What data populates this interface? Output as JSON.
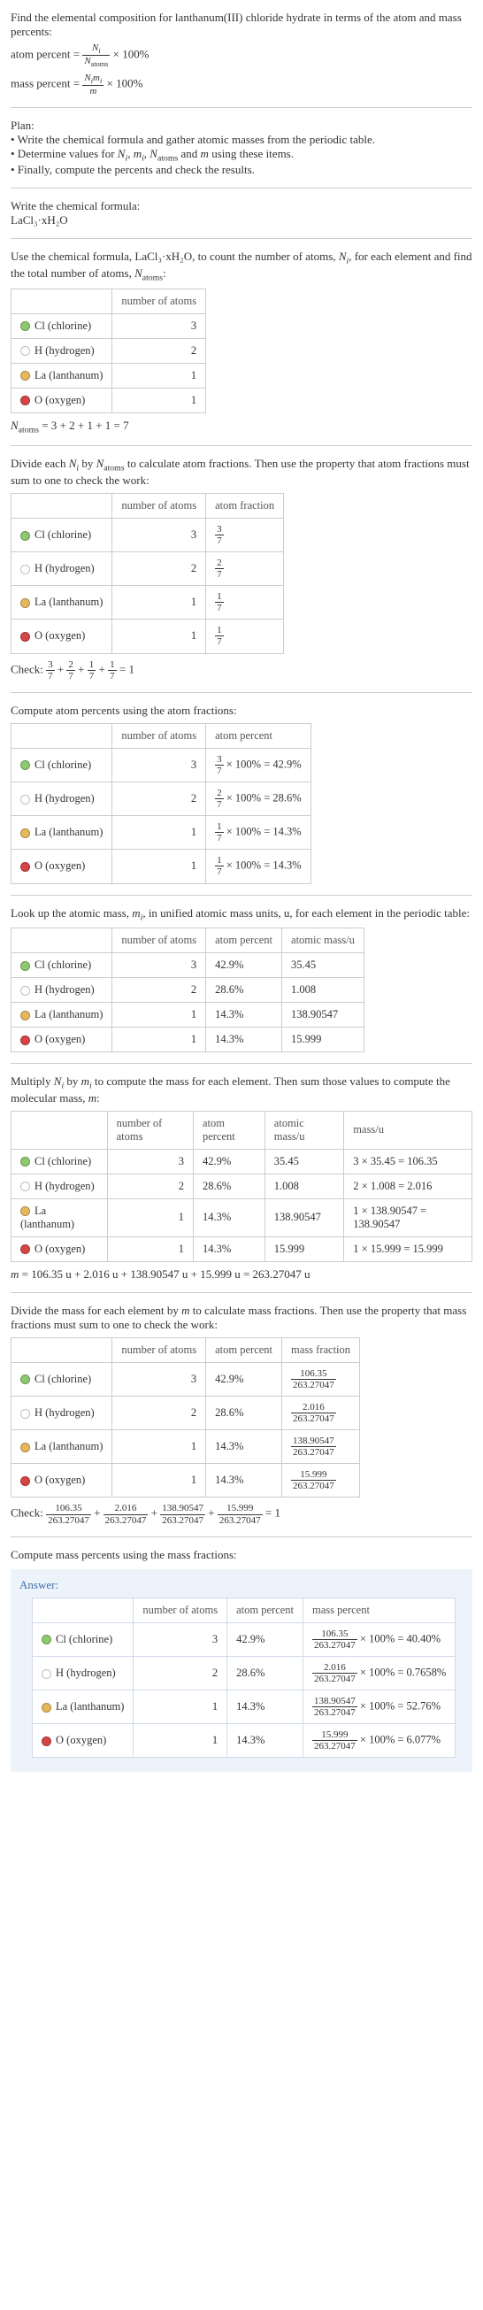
{
  "intro": {
    "line1": "Find the elemental composition for lanthanum(III) chloride hydrate in terms of the atom and mass percents:",
    "atom_percent_label": "atom percent =",
    "atom_percent_formula_num": "N_i",
    "atom_percent_formula_den": "N_atoms",
    "times100": "× 100%",
    "mass_percent_label": "mass percent =",
    "mass_percent_formula_num": "N_i m_i",
    "mass_percent_formula_den": "m"
  },
  "plan": {
    "title": "Plan:",
    "b1": "• Write the chemical formula and gather atomic masses from the periodic table.",
    "b2_prefix": "• Determine values for ",
    "b2_suffix": " using these items.",
    "b3": "• Finally, compute the percents and check the results."
  },
  "formula_section": {
    "title": "Write the chemical formula:",
    "formula": "LaCl₃·xH₂O"
  },
  "count_section": {
    "intro_a": "Use the chemical formula, LaCl₃·xH₂O, to count the number of atoms, ",
    "intro_b": ", for each element and find the total number of atoms, ",
    "intro_c": ":",
    "col_atoms": "number of atoms",
    "total_line": "N_atoms = 3 + 2 + 1 + 1 = 7"
  },
  "elements": [
    {
      "name": "Cl (chlorine)",
      "color": "#8fc96f",
      "atoms": "3",
      "frac_label": "3/7",
      "ap": "42.9%",
      "mass_u": "35.45",
      "mass_calc": "3 × 35.45 = 106.35",
      "mf_num": "106.35",
      "mp": "100% = 40.40%"
    },
    {
      "name": "H (hydrogen)",
      "color": "#ffffff",
      "atoms": "2",
      "frac_label": "2/7",
      "ap": "28.6%",
      "mass_u": "1.008",
      "mass_calc": "2 × 1.008 = 2.016",
      "mf_num": "2.016",
      "mp": "100% = 0.7658%"
    },
    {
      "name": "La (lanthanum)",
      "color": "#e6b85c",
      "atoms": "1",
      "frac_label": "1/7",
      "ap": "14.3%",
      "mass_u": "138.90547",
      "mass_calc": "1 × 138.90547 = 138.90547",
      "mf_num": "138.90547",
      "mp": "100% = 52.76%"
    },
    {
      "name": "O (oxygen)",
      "color": "#d64545",
      "atoms": "1",
      "frac_label": "1/7",
      "ap": "14.3%",
      "mass_u": "15.999",
      "mass_calc": "1 × 15.999 = 15.999",
      "mf_num": "15.999",
      "mp": "100% = 6.077%"
    }
  ],
  "atom_frac_section": {
    "intro": "Divide each N_i by N_atoms to calculate atom fractions. Then use the property that atom fractions must sum to one to check the work:",
    "col_atoms": "number of atoms",
    "col_frac": "atom fraction",
    "check_label": "Check: ",
    "check_eq": " = 1"
  },
  "atom_pct_section": {
    "intro": "Compute atom percents using the atom fractions:",
    "col_atoms": "number of atoms",
    "col_pct": "atom percent"
  },
  "mass_lookup_section": {
    "intro_a": "Look up the atomic mass, ",
    "intro_b": ", in unified atomic mass units, u, for each element in the periodic table:",
    "col_atoms": "number of atoms",
    "col_ap": "atom percent",
    "col_mu": "atomic mass/u"
  },
  "mass_calc_section": {
    "intro": "Multiply N_i by m_i to compute the mass for each element. Then sum those values to compute the molecular mass, m:",
    "col_atoms": "number of atoms",
    "col_ap": "atom percent",
    "col_mu": "atomic mass/u",
    "col_mass": "mass/u",
    "total_line": "m = 106.35 u + 2.016 u + 138.90547 u + 15.999 u = 263.27047 u"
  },
  "mass_frac_section": {
    "intro": "Divide the mass for each element by m to calculate mass fractions. Then use the property that mass fractions must sum to one to check the work:",
    "col_atoms": "number of atoms",
    "col_ap": "atom percent",
    "col_mf": "mass fraction",
    "den": "263.27047",
    "check_label": "Check: ",
    "check_eq": " = 1"
  },
  "mass_pct_section": {
    "intro": "Compute mass percents using the mass fractions:"
  },
  "answer": {
    "label": "Answer:",
    "col_atoms": "number of atoms",
    "col_ap": "atom percent",
    "col_mp": "mass percent",
    "den": "263.27047"
  },
  "chart_data": {
    "type": "table",
    "title": "Elemental composition of LaCl3·xH2O",
    "columns": [
      "element",
      "number_of_atoms",
      "atom_fraction",
      "atom_percent",
      "atomic_mass_u",
      "element_mass_u",
      "mass_fraction_num",
      "mass_fraction_den",
      "mass_percent"
    ],
    "rows": [
      {
        "element": "Cl (chlorine)",
        "number_of_atoms": 3,
        "atom_fraction": "3/7",
        "atom_percent": 42.9,
        "atomic_mass_u": 35.45,
        "element_mass_u": 106.35,
        "mass_fraction_num": 106.35,
        "mass_fraction_den": 263.27047,
        "mass_percent": 40.4
      },
      {
        "element": "H (hydrogen)",
        "number_of_atoms": 2,
        "atom_fraction": "2/7",
        "atom_percent": 28.6,
        "atomic_mass_u": 1.008,
        "element_mass_u": 2.016,
        "mass_fraction_num": 2.016,
        "mass_fraction_den": 263.27047,
        "mass_percent": 0.7658
      },
      {
        "element": "La (lanthanum)",
        "number_of_atoms": 1,
        "atom_fraction": "1/7",
        "atom_percent": 14.3,
        "atomic_mass_u": 138.90547,
        "element_mass_u": 138.90547,
        "mass_fraction_num": 138.90547,
        "mass_fraction_den": 263.27047,
        "mass_percent": 52.76
      },
      {
        "element": "O (oxygen)",
        "number_of_atoms": 1,
        "atom_fraction": "1/7",
        "atom_percent": 14.3,
        "atomic_mass_u": 15.999,
        "element_mass_u": 15.999,
        "mass_fraction_num": 15.999,
        "mass_fraction_den": 263.27047,
        "mass_percent": 6.077
      }
    ],
    "totals": {
      "N_atoms": 7,
      "molecular_mass_u": 263.27047
    }
  }
}
